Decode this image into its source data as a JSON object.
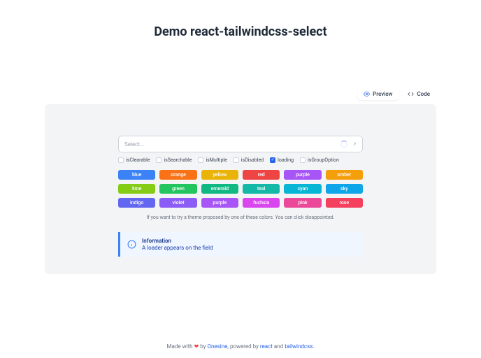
{
  "title": "Demo react-tailwindcss-select",
  "tabs": {
    "preview": "Preview",
    "code": "Code"
  },
  "select": {
    "placeholder": "Select..."
  },
  "options": [
    {
      "label": "isClearable",
      "checked": false
    },
    {
      "label": "isSearchable",
      "checked": false
    },
    {
      "label": "isMultiple",
      "checked": false
    },
    {
      "label": "isDisabled",
      "checked": false
    },
    {
      "label": "loading",
      "checked": true
    },
    {
      "label": "isGroupOption",
      "checked": false
    }
  ],
  "colors": [
    {
      "name": "blue",
      "hex": "#3b82f6"
    },
    {
      "name": "orange",
      "hex": "#f97316"
    },
    {
      "name": "yellow",
      "hex": "#eab308"
    },
    {
      "name": "red",
      "hex": "#ef4444"
    },
    {
      "name": "purple",
      "hex": "#a855f7"
    },
    {
      "name": "amber",
      "hex": "#f59e0b"
    },
    {
      "name": "lime",
      "hex": "#84cc16"
    },
    {
      "name": "green",
      "hex": "#22c55e"
    },
    {
      "name": "emerald",
      "hex": "#10b981"
    },
    {
      "name": "teal",
      "hex": "#14b8a6"
    },
    {
      "name": "cyan",
      "hex": "#06b6d4"
    },
    {
      "name": "sky",
      "hex": "#0ea5e9"
    },
    {
      "name": "indigo",
      "hex": "#6366f1"
    },
    {
      "name": "violet",
      "hex": "#8b5cf6"
    },
    {
      "name": "purple",
      "hex": "#a855f7"
    },
    {
      "name": "fuchsia",
      "hex": "#d946ef"
    },
    {
      "name": "pink",
      "hex": "#ec4899"
    },
    {
      "name": "rose",
      "hex": "#f43f5e"
    }
  ],
  "note": "If you want to try a theme proposed by one of these colors. You can click disappointed.",
  "info": {
    "title": "Information",
    "desc": "A loader appears on the field"
  },
  "footer": {
    "made": "Made with ",
    "by": " by ",
    "author": "Onesine",
    "powered": ", powered by ",
    "react": "react",
    "and": " and ",
    "tailwind": "tailwindcss",
    "dot": "."
  }
}
